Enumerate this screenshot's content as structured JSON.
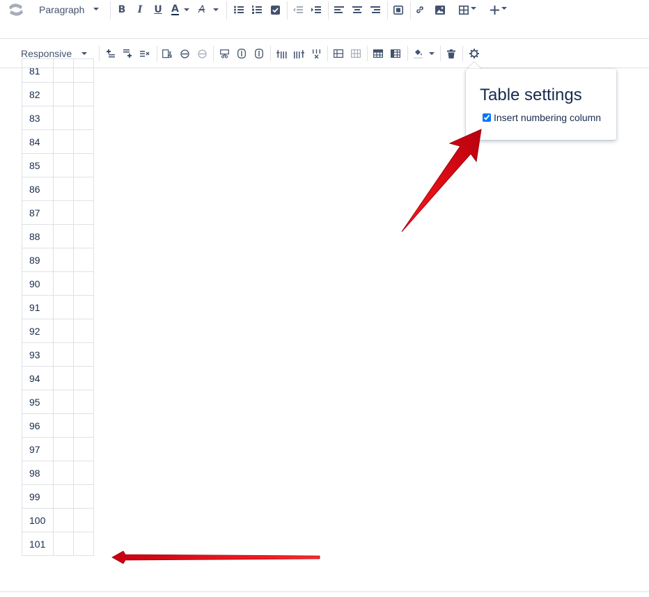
{
  "toolbar_main": {
    "paragraph_label": "Paragraph",
    "bold_glyph": "B",
    "italic_glyph": "I",
    "underline_glyph": "U",
    "text_color_glyph": "A",
    "more_formatting_glyph": "A"
  },
  "toolbar_table": {
    "layout_label": "Responsive"
  },
  "table": {
    "row_numbers": [
      "81",
      "82",
      "83",
      "84",
      "85",
      "86",
      "87",
      "88",
      "89",
      "90",
      "91",
      "92",
      "93",
      "94",
      "95",
      "96",
      "97",
      "98",
      "99",
      "100",
      "101"
    ]
  },
  "table_settings": {
    "title": "Table settings",
    "numbering_label": "Insert numbering column",
    "numbering_checked": true
  },
  "colors": {
    "annotation_red": "#e3001b",
    "toolbar_icon": "#42526e",
    "border": "#dfe1e6"
  }
}
